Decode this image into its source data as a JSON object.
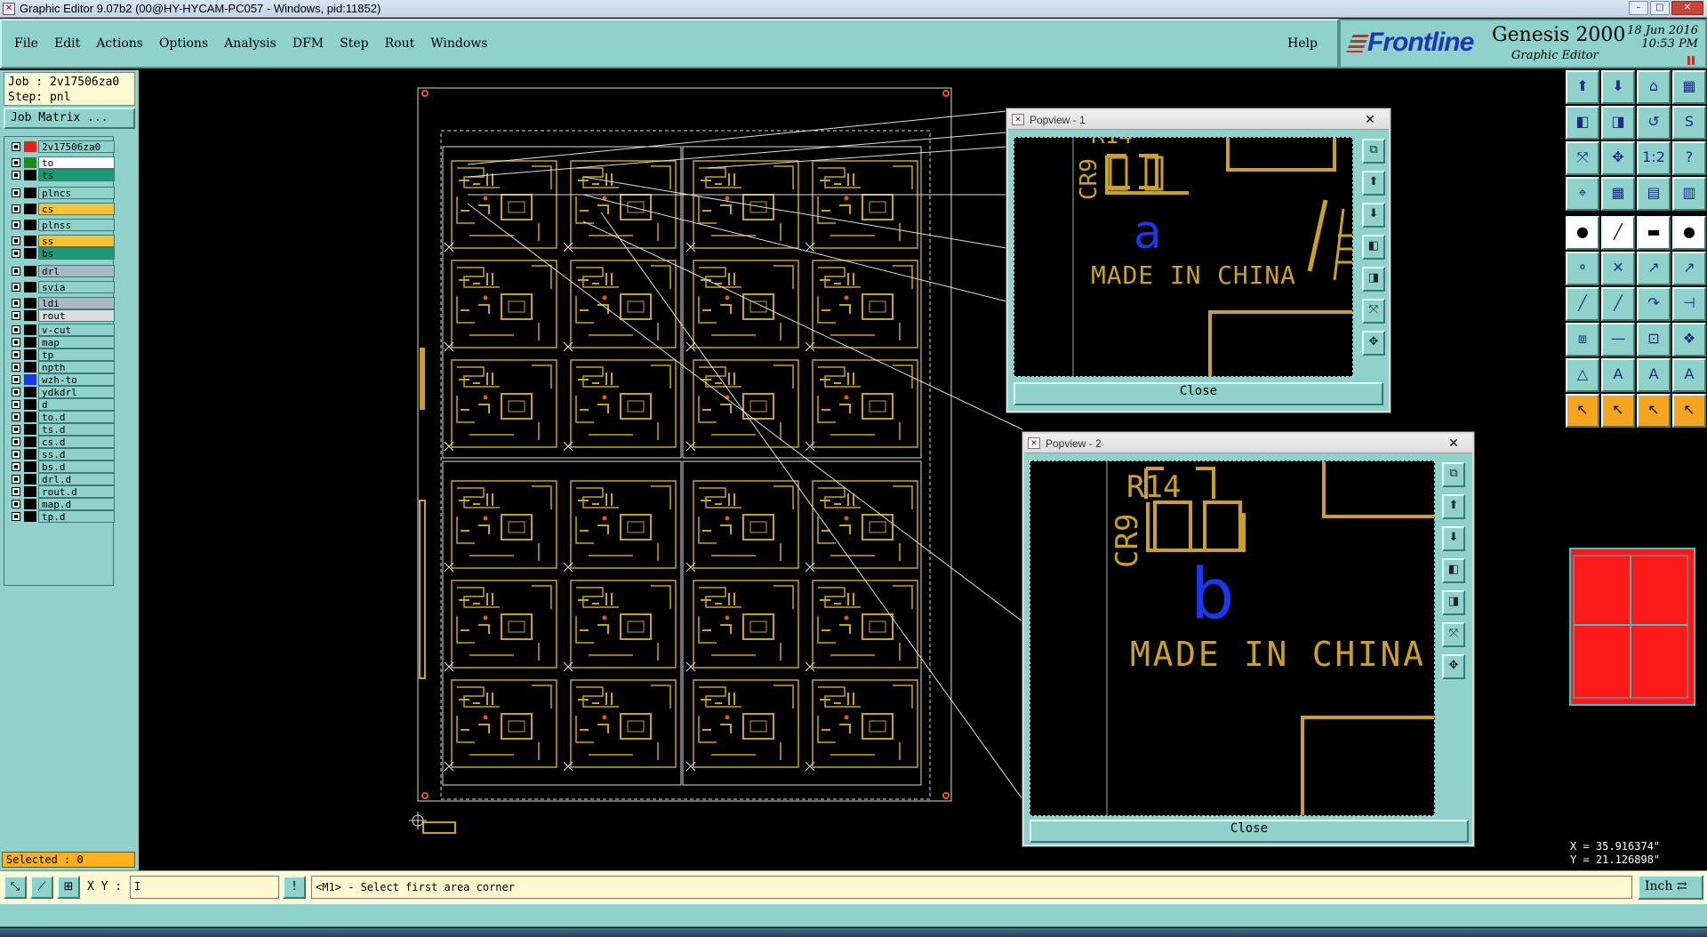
{
  "window": {
    "title": "Graphic Editor 9.07b2 (00@HY-HYCAM-PC057 - Windows, pid:11852)",
    "min": "–",
    "max": "□",
    "close": "✕"
  },
  "menu": {
    "items": [
      "File",
      "Edit",
      "Actions",
      "Options",
      "Analysis",
      "DFM",
      "Step",
      "Rout",
      "Windows"
    ],
    "help": "Help"
  },
  "brand": {
    "logo": "Frontline",
    "product": "Genesis 2000",
    "subtitle": "Graphic Editor",
    "date": "18 Jun 2016",
    "time": "10:53 PM"
  },
  "job": {
    "job_line": "Job : 2v17506za0",
    "step_line": "Step: pnl",
    "matrix_button": "Job Matrix ..."
  },
  "layers": [
    {
      "name": "2v17506za0",
      "swatch": "#e0241c",
      "bg": "#8fd1cb"
    },
    {
      "name": "to",
      "swatch": "#1f8a1f",
      "bg": "#ffffff"
    },
    {
      "name": "ts",
      "swatch": "#000000",
      "bg": "#1a9a74"
    },
    {
      "name": "plncs",
      "swatch": "#000000",
      "bg": "#8fd1cb"
    },
    {
      "name": "cs",
      "swatch": "#000000",
      "bg": "#f6c23a"
    },
    {
      "name": "plnss",
      "swatch": "#000000",
      "bg": "#8fd1cb"
    },
    {
      "name": "ss",
      "swatch": "#000000",
      "bg": "#f6c23a"
    },
    {
      "name": "bs",
      "swatch": "#000000",
      "bg": "#1a9a74"
    },
    {
      "name": "drl",
      "swatch": "#000000",
      "bg": "#a8b8c4"
    },
    {
      "name": "svia",
      "swatch": "#000000",
      "bg": "#8fd1cb"
    },
    {
      "name": "ldi",
      "swatch": "#000000",
      "bg": "#a8b8c4"
    },
    {
      "name": "rout",
      "swatch": "#000000",
      "bg": "#dcdcdc"
    },
    {
      "name": "v-cut",
      "swatch": "#000000",
      "bg": "#8fd1cb"
    },
    {
      "name": "map",
      "swatch": "#000000",
      "bg": "#8fd1cb"
    },
    {
      "name": "tp",
      "swatch": "#000000",
      "bg": "#8fd1cb"
    },
    {
      "name": "npth",
      "swatch": "#000000",
      "bg": "#8fd1cb"
    },
    {
      "name": "wzh-to",
      "swatch": "#1c36e8",
      "bg": "#8fd1cb"
    },
    {
      "name": "ydkdrl",
      "swatch": "#000000",
      "bg": "#8fd1cb"
    },
    {
      "name": "d",
      "swatch": "#000000",
      "bg": "#8fd1cb"
    },
    {
      "name": "to.d",
      "swatch": "#000000",
      "bg": "#8fd1cb"
    },
    {
      "name": "ts.d",
      "swatch": "#000000",
      "bg": "#8fd1cb"
    },
    {
      "name": "cs.d",
      "swatch": "#000000",
      "bg": "#8fd1cb"
    },
    {
      "name": "ss.d",
      "swatch": "#000000",
      "bg": "#8fd1cb"
    },
    {
      "name": "bs.d",
      "swatch": "#000000",
      "bg": "#8fd1cb"
    },
    {
      "name": "drl.d",
      "swatch": "#000000",
      "bg": "#8fd1cb"
    },
    {
      "name": "rout.d",
      "swatch": "#000000",
      "bg": "#8fd1cb"
    },
    {
      "name": "map.d",
      "swatch": "#000000",
      "bg": "#8fd1cb"
    },
    {
      "name": "tp.d",
      "swatch": "#000000",
      "bg": "#8fd1cb"
    }
  ],
  "selected": "Selected : 0",
  "popview1": {
    "title": "Popview - 1",
    "close_x": "✕",
    "ref_top": "R14",
    "ref_side": "CR9",
    "letter": "a",
    "marking": "MADE IN CHINA",
    "close_button": "Close"
  },
  "popview2": {
    "title": "Popview - 2",
    "close_x": "✕",
    "ref_top": "R14",
    "ref_side": "CR9",
    "letter": "b",
    "marking": "MADE IN CHINA",
    "close_button": "Close"
  },
  "toolbar": {
    "icons": [
      "zoom-home-icon",
      "zoom-in-icon",
      "home-icon",
      "grid-icon",
      "pan-left-icon",
      "pan-right-icon",
      "zoom-ratio-icon",
      "snap-icon",
      "fit-icon",
      "center-icon",
      "scale-icon",
      "query-icon",
      "measure-icon",
      "grid-toggle-icon",
      "layers-icon",
      "display-icon",
      "pad-icon",
      "line-icon",
      "ruler-icon",
      "circle-icon",
      "connect-icon",
      "cross-icon",
      "move-icon",
      "copy-icon",
      "draw-line-icon",
      "draw-slash-icon",
      "arc-icon",
      "align-icon",
      "select-icon",
      "delete-icon",
      "resize-icon",
      "group-icon",
      "triangle-icon",
      "text-a-icon",
      "text-b-icon",
      "text-c-icon",
      "pointer-icon",
      "pointer-select-icon",
      "pointer-edit-icon",
      "pointer-route-icon"
    ],
    "glyphs": [
      "⬆",
      "⬇",
      "⌂",
      "▦",
      "◧",
      "◨",
      "↺",
      "S",
      "⤧",
      "✥",
      "1:2",
      "?",
      "⌖",
      "▦",
      "▤",
      "▥",
      "●",
      "╱",
      "▬",
      "●",
      "⚬",
      "✕",
      "↗",
      "↗",
      "╱",
      "╱",
      "↷",
      "⊣",
      "⧈",
      "—",
      "⊡",
      "❖",
      "△",
      "A",
      "A",
      "A",
      "↖",
      "↖",
      "↖",
      "↖"
    ],
    "styles": [
      "",
      "",
      "",
      "",
      "",
      "",
      "",
      "",
      "",
      "",
      "",
      "",
      "",
      "",
      "",
      "",
      "white",
      "white",
      "white",
      "white",
      "",
      "",
      "",
      "",
      "",
      "",
      "",
      "",
      "",
      "",
      "",
      "",
      "",
      "",
      "",
      "",
      "orange",
      "orange",
      "orange",
      "orange"
    ]
  },
  "coords": {
    "x": "X = 35.916374\"",
    "y": "Y = 21.126898\""
  },
  "cmd": {
    "xy_label": "X Y :",
    "xy_value": "I",
    "prompt": "<M1> - Select first area corner",
    "units": "Inch ⇄"
  },
  "colors": {
    "panel": "#8fd1cb",
    "trace": "#c9a12a",
    "highlight_letter": "#1c36e8",
    "minimap_fill": "#ff1a1a"
  }
}
